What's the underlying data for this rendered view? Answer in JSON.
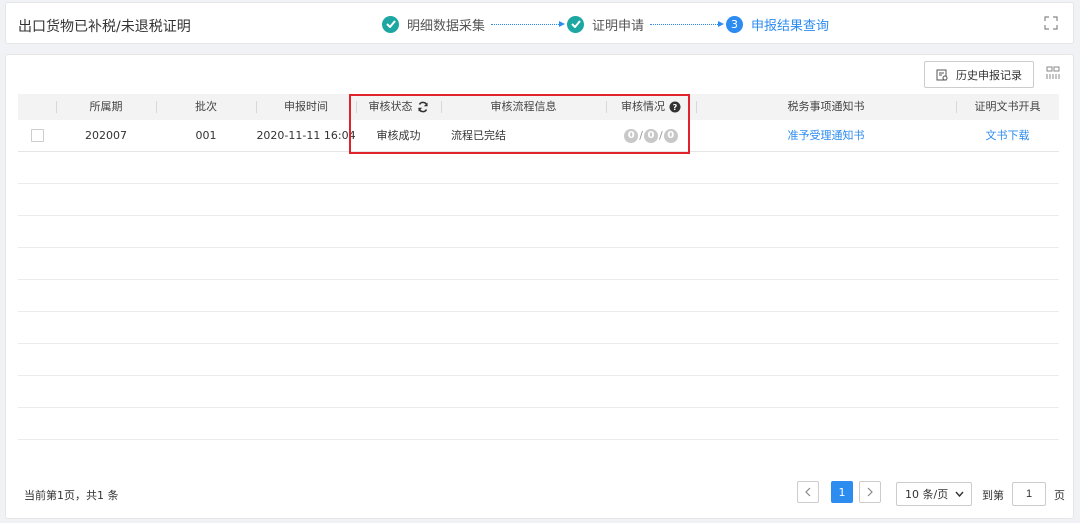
{
  "header": {
    "title": "出口货物已补税/未退税证明",
    "steps": [
      {
        "label": "明细数据采集",
        "status": "done"
      },
      {
        "label": "证明申请",
        "status": "done"
      },
      {
        "label": "申报结果查询",
        "status": "active",
        "number": "3"
      }
    ]
  },
  "toolbar": {
    "history_label": "历史申报记录"
  },
  "table": {
    "columns": [
      "",
      "所属期",
      "批次",
      "申报时间",
      "审核状态",
      "审核流程信息",
      "审核情况",
      "税务事项通知书",
      "证明文书开具"
    ],
    "rows": [
      {
        "period": "202007",
        "batch": "001",
        "time": "2020-11-11 16:04",
        "status": "审核成功",
        "flow": "流程已完结",
        "review": [
          "0",
          "0",
          "0"
        ],
        "notice": "准予受理通知书",
        "doc": "文书下载"
      }
    ]
  },
  "footer": {
    "summary": "当前第1页，共1 条",
    "current_page": "1",
    "page_size": "10 条/页",
    "goto_label": "到第",
    "goto_value": "1",
    "page_label": "页"
  },
  "colors": {
    "primary": "#2d8cf0",
    "success": "#1ea7a2",
    "highlight": "#e0222c"
  }
}
